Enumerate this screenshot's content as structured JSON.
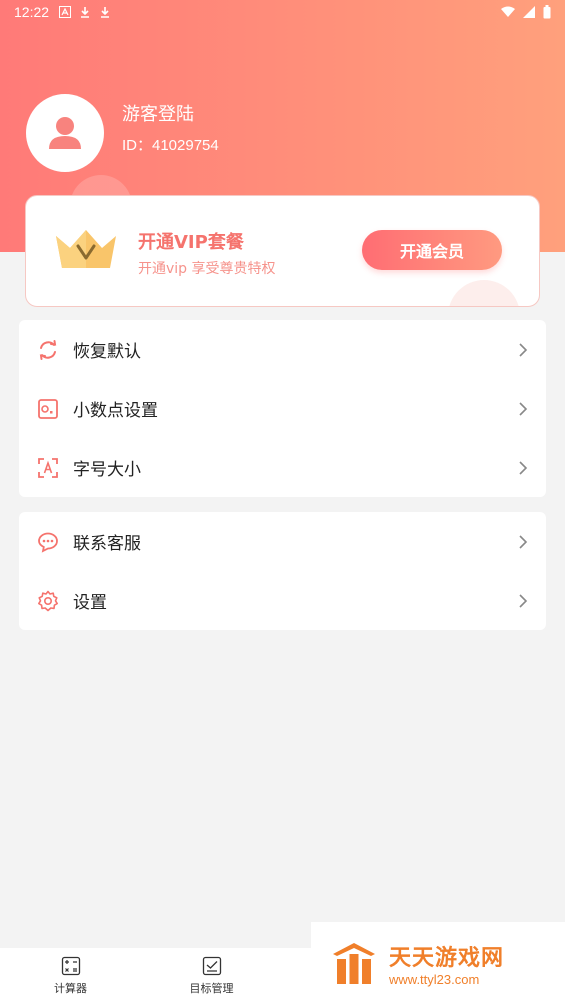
{
  "status_bar": {
    "time": "12:22",
    "left_icons": [
      "app-a-icon",
      "download-icon",
      "download-icon"
    ],
    "right_icons": [
      "wifi-icon",
      "signal-icon",
      "battery-icon"
    ]
  },
  "profile": {
    "username": "游客登陆",
    "id_text": "ID：41029754"
  },
  "vip": {
    "title": "开通VIP套餐",
    "subtitle": "开通vip 享受尊贵特权",
    "button_label": "开通会员"
  },
  "menu_group_1": [
    {
      "label": "恢复默认",
      "icon": "refresh-icon"
    },
    {
      "label": "小数点设置",
      "icon": "decimal-icon"
    },
    {
      "label": "字号大小",
      "icon": "font-size-icon"
    }
  ],
  "menu_group_2": [
    {
      "label": "联系客服",
      "icon": "chat-icon"
    },
    {
      "label": "设置",
      "icon": "gear-icon"
    }
  ],
  "tabbar": [
    {
      "label": "计算器",
      "icon": "calculator-icon"
    },
    {
      "label": "目标管理",
      "icon": "checklist-icon"
    }
  ],
  "watermark": {
    "title": "天天游戏网",
    "url": "www.ttyl23.com"
  },
  "colors": {
    "accent": "#f5736d",
    "header_gradient_start": "#ff7a78",
    "header_gradient_end": "#ffa07c"
  }
}
